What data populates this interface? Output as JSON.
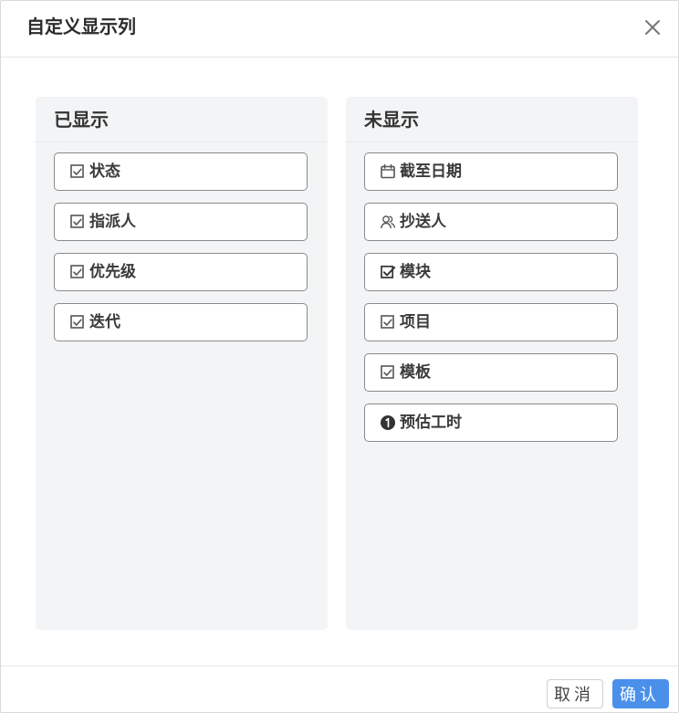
{
  "dialog": {
    "title": "自定义显示列"
  },
  "panels": {
    "shown": {
      "title": "已显示",
      "items": [
        {
          "label": "状态",
          "icon": "checkbox-icon"
        },
        {
          "label": "指派人",
          "icon": "checkbox-icon"
        },
        {
          "label": "优先级",
          "icon": "checkbox-icon"
        },
        {
          "label": "迭代",
          "icon": "checkbox-icon"
        }
      ]
    },
    "hidden": {
      "title": "未显示",
      "items": [
        {
          "label": "截至日期",
          "icon": "calendar-icon"
        },
        {
          "label": "抄送人",
          "icon": "users-icon"
        },
        {
          "label": "模块",
          "icon": "checkbox-checked-icon"
        },
        {
          "label": "项目",
          "icon": "checkbox-icon"
        },
        {
          "label": "模板",
          "icon": "checkbox-icon"
        },
        {
          "label": "预估工时",
          "icon": "number-one-icon"
        }
      ]
    }
  },
  "footer": {
    "cancel_label": "取消",
    "confirm_label": "确认"
  },
  "colors": {
    "primary": "#4a90ea",
    "panel_bg": "#f3f4f6",
    "item_border": "#8a8a8a"
  }
}
